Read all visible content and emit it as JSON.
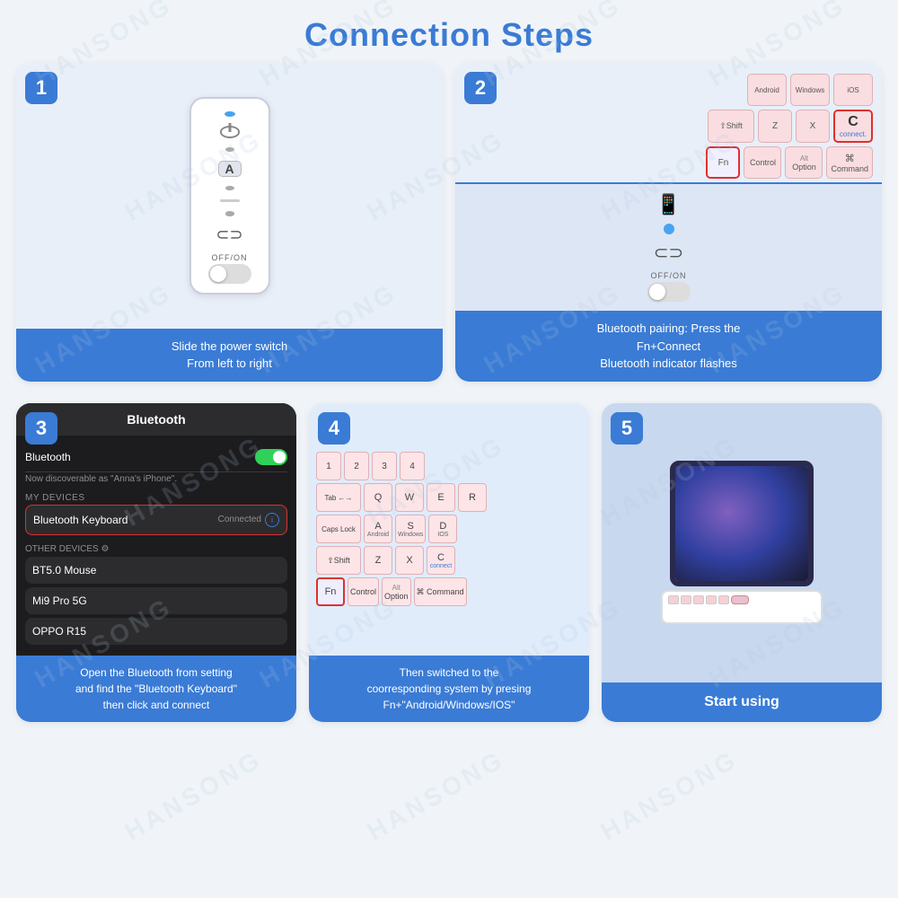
{
  "page": {
    "title": "Connection Steps",
    "watermark": "HANSONG"
  },
  "steps": [
    {
      "number": "1",
      "caption": "Slide the power switch\nFrom left to right"
    },
    {
      "number": "2",
      "caption": "Bluetooth pairing: Press the\nFn+Connect\nBluetooth indicator flashes"
    },
    {
      "number": "3",
      "caption": "Open the Bluetooth from setting\nand find the \"Bluetooth Keyboard\"\nthen click and connect"
    },
    {
      "number": "4",
      "caption": "Then switched to the\ncoorresponding system by presing\nFn+\"Android/Windows/IOS\""
    },
    {
      "number": "5",
      "caption": "Start using"
    }
  ],
  "step2": {
    "keys_row1": [
      "Android",
      "Windows",
      "iOS"
    ],
    "keys_row2_shift": "⇧Shift",
    "keys_z": "Z",
    "keys_x": "X",
    "keys_c": "C",
    "keys_connect": "connect.",
    "keys_fn": "Fn",
    "keys_control": "Control",
    "keys_option": "Option",
    "keys_command": "Command",
    "off_on": "OFF/ON"
  },
  "step3": {
    "header": "Bluetooth",
    "bluetooth_label": "Bluetooth",
    "discoverable": "Now discoverable as \"Anna's iPhone\".",
    "my_devices": "MY DEVICES",
    "bt_keyboard": "Bluetooth Keyboard",
    "connected": "Connected",
    "other_devices": "OTHER DEVICES",
    "device1": "BT5.0 Mouse",
    "device2": "Mi9 Pro 5G",
    "device3": "OPPO R15"
  },
  "step4": {
    "num_row": [
      "1",
      "2",
      "3",
      "4"
    ],
    "row_q": [
      "Q",
      "W",
      "E",
      "R"
    ],
    "row_a": [
      "A",
      "S",
      "D"
    ],
    "row_a_sub": [
      "Android",
      "Windows",
      "IOS"
    ],
    "row_z": [
      "Z",
      "X",
      "C"
    ],
    "row_z_sub": [
      "",
      "",
      "connect"
    ],
    "tab_label": "Tab ←→",
    "caps_lock": "Caps Lock",
    "shift_label": "⇧Shift",
    "fn_label": "Fn",
    "control_label": "Control",
    "option_label": "Option",
    "command_label": "Command"
  },
  "icons": {
    "info": "ⓘ",
    "phone": "📱",
    "bluetooth": "⚡"
  }
}
